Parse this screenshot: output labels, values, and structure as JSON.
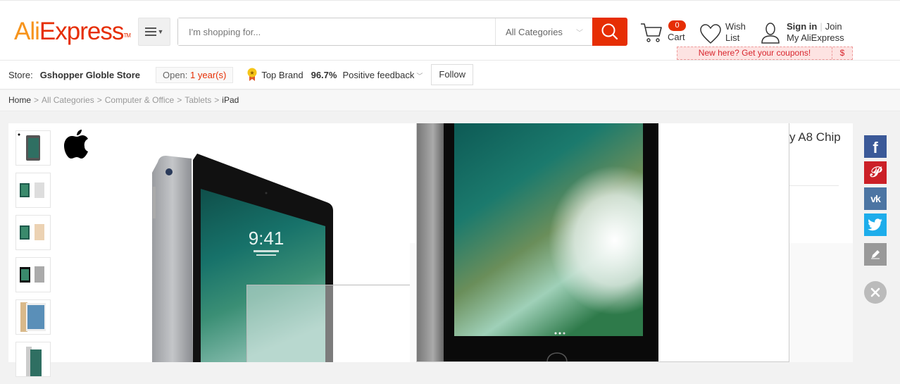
{
  "header": {
    "logo_part1": "Ali",
    "logo_part2": "Express",
    "logo_tm": "TM",
    "search_placeholder": "I'm shopping for...",
    "search_category": "All Categories",
    "cart_count": "0",
    "cart_label": "Cart",
    "wish_line1": "Wish",
    "wish_line2": "List",
    "sign_in": "Sign in",
    "join": "Join",
    "my_account": "My AliExpress",
    "coupon_text": "New here? Get your coupons!",
    "coupon_icon": "$"
  },
  "store": {
    "label": "Store:",
    "name": "Gshopper Globle Store",
    "open_label": "Open:",
    "open_value": "1 year(s)",
    "badge": "Top Brand",
    "feedback_pct": "96.7%",
    "feedback_label": "Positive feedback",
    "follow": "Follow"
  },
  "breadcrumb": [
    "Home",
    "All Categories",
    "Computer & Office",
    "Tablets",
    "iPad"
  ],
  "product": {
    "title_fragment": "y A8 Chip",
    "thumbnails": [
      "space-gray-front",
      "silver-pair",
      "gold-pair",
      "space-gray-pair",
      "gold-homescreen",
      "silver-angle"
    ],
    "screen_time": "9:41"
  },
  "social": [
    "facebook",
    "pinterest",
    "vk",
    "twitter",
    "edit",
    "close"
  ],
  "colors": {
    "brand_orange": "#e62e04",
    "logo_orange": "#f7941d",
    "coupon_bg": "#fde3e2",
    "facebook": "#3b5998",
    "pinterest": "#cb2027",
    "vk": "#4c75a3",
    "twitter": "#1dadeb"
  }
}
